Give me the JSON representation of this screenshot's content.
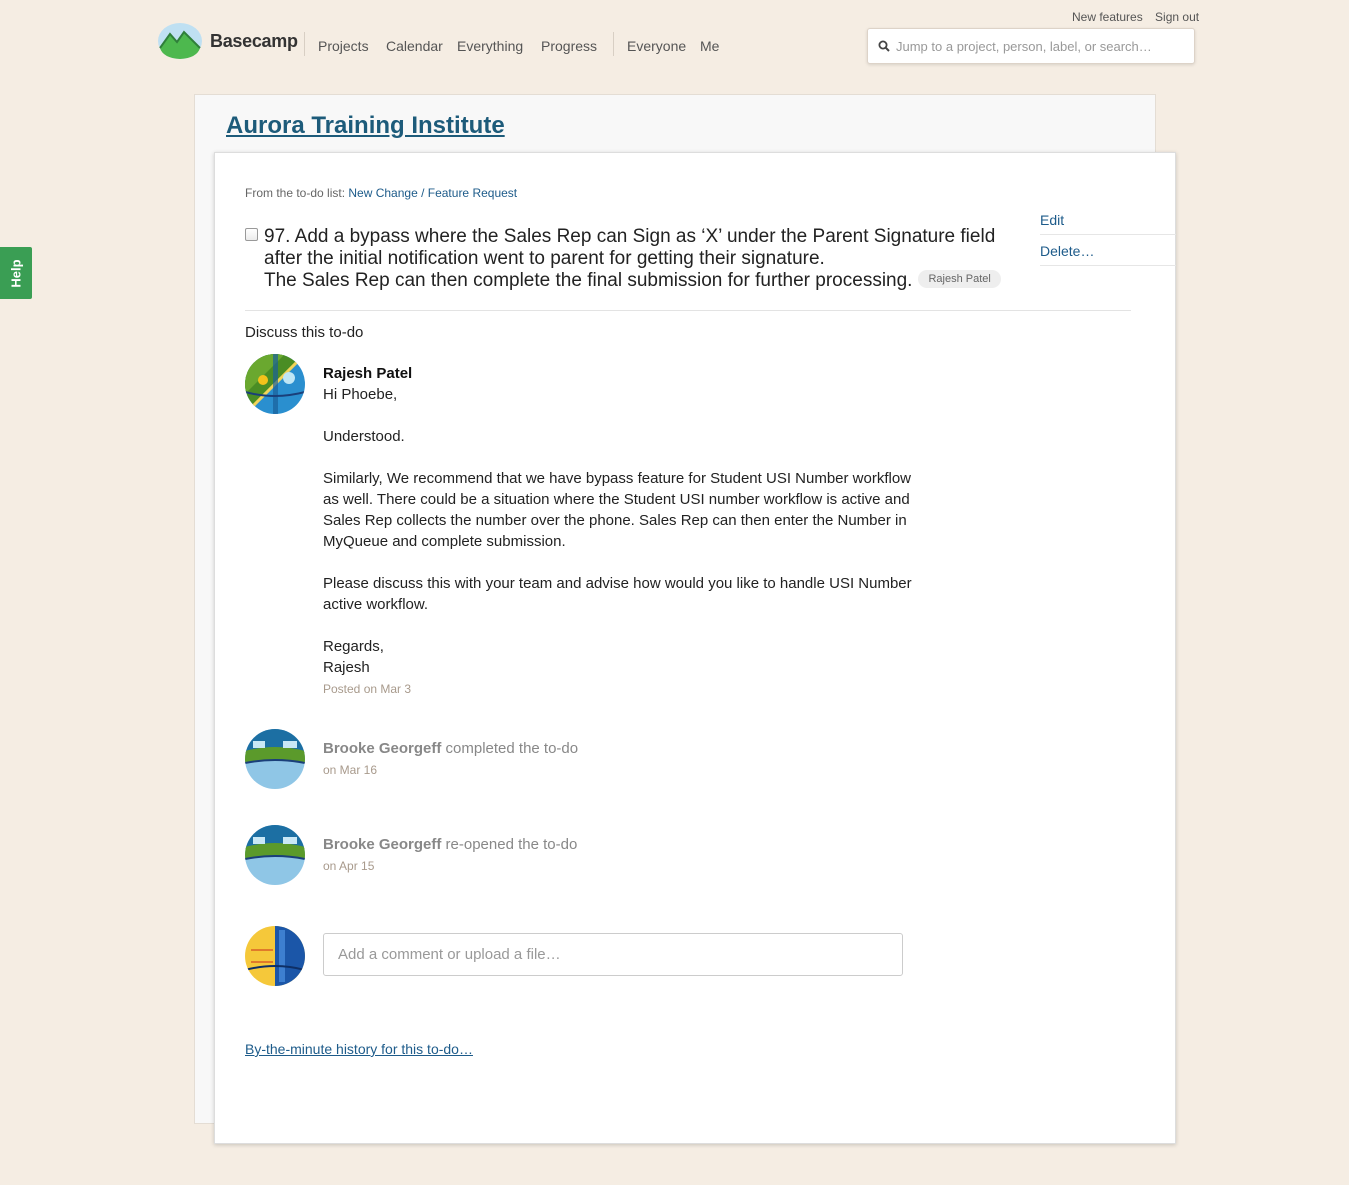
{
  "top_links": {
    "new_features": "New features",
    "sign_out": "Sign out"
  },
  "brand": {
    "name": "Basecamp",
    "logo_icon": "mountain-logo-icon"
  },
  "nav": {
    "projects": "Projects",
    "calendar": "Calendar",
    "everything": "Everything",
    "progress": "Progress",
    "everyone": "Everyone",
    "me": "Me"
  },
  "search": {
    "placeholder": "Jump to a project, person, label, or search…",
    "icon": "search-icon"
  },
  "help": {
    "label": "Help"
  },
  "project": {
    "title": "Aurora Training Institute"
  },
  "todo": {
    "from_prefix": "From the to-do list:",
    "list_name": "New Change / Feature Request",
    "line1": "97. Add a bypass where the Sales Rep can Sign as ‘X’ under the Parent Signature field",
    "line2": "after the initial notification went to parent for getting their signature.",
    "line3": "The Sales Rep can then complete the final submission for further processing.",
    "assignee": "Rajesh Patel",
    "checked": false
  },
  "actions": {
    "edit": "Edit",
    "delete": "Delete…"
  },
  "discussion": {
    "title": "Discuss this to-do",
    "comment": {
      "author": "Rajesh Patel",
      "paragraphs": [
        "Hi Phoebe,",
        "Understood.",
        "Similarly, We recommend that we have bypass feature for Student USI Number workflow as well. There could be a situation where the Student USI number workflow is active and Sales Rep collects the number over the phone. Sales Rep can then enter the Number in MyQueue and complete submission.",
        "Please discuss this with your team and advise how would you like to handle USI Number active workflow."
      ],
      "signoff": "Regards,",
      "signature": "Rajesh",
      "posted": "Posted on Mar 3"
    },
    "events": [
      {
        "actor": "Brooke Georgeff",
        "action": "completed the to-do",
        "date": "on Mar 16"
      },
      {
        "actor": "Brooke Georgeff",
        "action": "re-opened the to-do",
        "date": "on Apr 15"
      }
    ],
    "new_comment": {
      "placeholder": "Add a comment or upload a file…"
    }
  },
  "history_link": "By-the-minute history for this to-do…"
}
